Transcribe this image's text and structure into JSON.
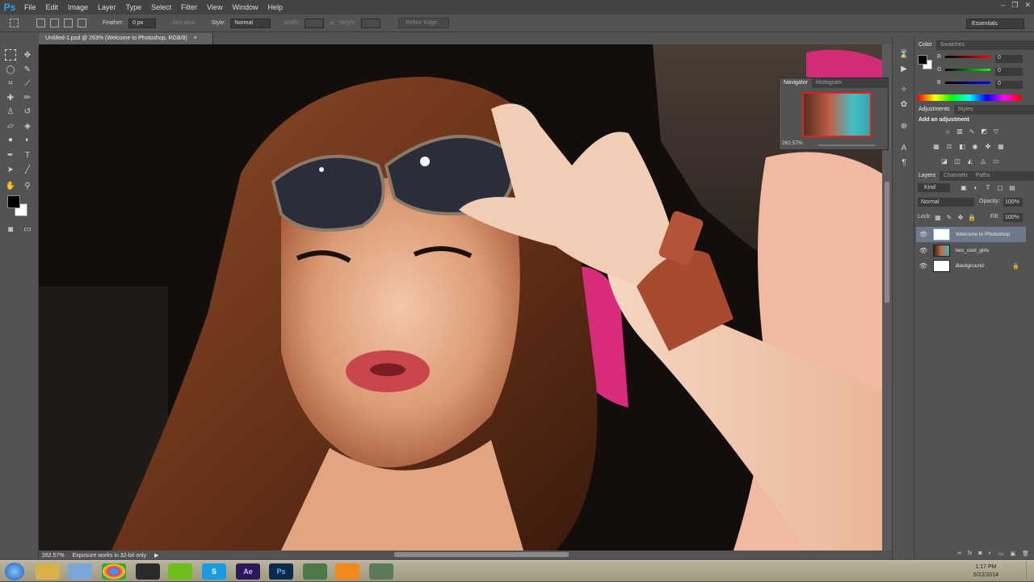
{
  "app": {
    "logo": "Ps"
  },
  "menubar": [
    "File",
    "Edit",
    "Image",
    "Layer",
    "Type",
    "Select",
    "Filter",
    "View",
    "Window",
    "Help"
  ],
  "window_controls": {
    "minimize": "–",
    "restore": "❐",
    "close": "✕"
  },
  "options_bar": {
    "feather_label": "Feather:",
    "feather_value": "0 px",
    "anti_alias_label": "Anti-alias",
    "style_label": "Style:",
    "style_value": "Normal",
    "width_label": "Width:",
    "height_label": "Height:",
    "refine_edge": "Refine Edge...",
    "workspace": "Essentials"
  },
  "document": {
    "tab_title": "Untitled-1.psd @ 263% (Welcome to Photoshop, RGB/8)",
    "close": "×"
  },
  "status": {
    "zoom": "262.57%",
    "message": "Exposure works in 32-bit only"
  },
  "navigator": {
    "tabs": [
      "Navigator",
      "Histogram"
    ],
    "zoom": "262.57%"
  },
  "color_panel": {
    "tabs": [
      "Color",
      "Swatches"
    ],
    "channels": [
      {
        "label": "R",
        "value": "0"
      },
      {
        "label": "G",
        "value": "0"
      },
      {
        "label": "B",
        "value": "0"
      }
    ]
  },
  "adjustments_panel": {
    "tabs": [
      "Adjustments",
      "Styles"
    ],
    "title": "Add an adjustment"
  },
  "layers_panel": {
    "tabs": [
      "Layers",
      "Channels",
      "Paths"
    ],
    "kind": "Kind",
    "blend_mode": "Normal",
    "opacity_label": "Opacity:",
    "opacity_value": "100%",
    "lock_label": "Lock:",
    "fill_label": "Fill:",
    "fill_value": "100%",
    "layers": [
      {
        "name": "Welcome to Photoshop",
        "selected": true
      },
      {
        "name": "two_cool_girls",
        "selected": false
      },
      {
        "name": "Background",
        "selected": false,
        "locked": true
      }
    ]
  },
  "taskbar": {
    "apps": [
      "Windows Explorer",
      "Notepad",
      "Chrome",
      "Steam",
      "Spotify",
      "Skype",
      "Ae",
      "Ps",
      "App",
      "VLC",
      "App2"
    ],
    "time": "1:17 PM",
    "date": "6/22/2014"
  },
  "colors": {
    "accent": "#2fa3f6",
    "panel": "#535353",
    "dark": "#3f3f3f"
  }
}
